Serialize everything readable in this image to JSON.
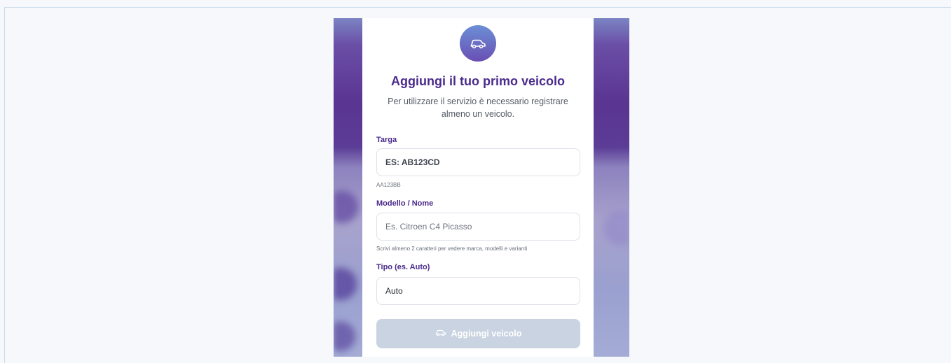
{
  "dialog": {
    "title": "Aggiungi il tuo primo veicolo",
    "subtitle": "Per utilizzare il servizio è necessario registrare almeno un veicolo.",
    "logo_icon": "car-icon"
  },
  "form": {
    "plate": {
      "label": "Targa",
      "placeholder": "ES: AB123CD",
      "hint": "AA123BB"
    },
    "model": {
      "label": "Modello / Nome",
      "placeholder": "Es. Citroen C4 Picasso",
      "hint": "Scrivi almeno 2 caratteri per vedere marca, modelli e varianti"
    },
    "type": {
      "label": "Tipo (es. Auto)",
      "value": "Auto"
    },
    "submit": {
      "label": "Aggiungi veicolo",
      "icon": "car-icon"
    }
  },
  "colors": {
    "accent": "#4a2a8c",
    "button_disabled": "#c9d3e1"
  }
}
